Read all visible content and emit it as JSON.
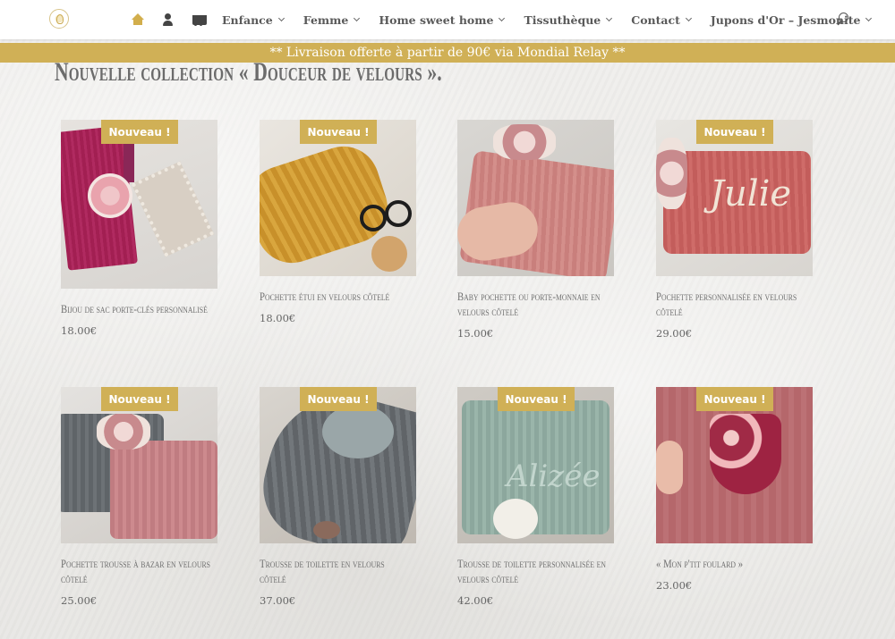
{
  "nav": {
    "items": [
      {
        "label": "Enfance"
      },
      {
        "label": "Femme"
      },
      {
        "label": "Home sweet home"
      },
      {
        "label": "Tissuthèque"
      },
      {
        "label": "Contact"
      },
      {
        "label": "Jupons d'Or – Jesmonite"
      }
    ]
  },
  "banner": {
    "text": "** Livraison offerte à partir de 90€ via Mondial Relay **"
  },
  "section": {
    "title": "Nouvelle collection « Douceur de velours »."
  },
  "badge_label": "Nouveau !",
  "products": [
    {
      "title": "Bijou de sac porte-clés personnalisé",
      "price": "18.00€",
      "badge": "Nouveau !"
    },
    {
      "title": "Pochette étui en velours côtelé",
      "price": "18.00€",
      "badge": "Nouveau !"
    },
    {
      "title": "Baby pochette ou porte-monnaie en velours côtelé",
      "price": "15.00€",
      "badge": ""
    },
    {
      "title": "Pochette personnalisée en velours côtelé",
      "price": "29.00€",
      "badge": "Nouveau !"
    },
    {
      "title": "Pochette trousse à bazar en velours côtelé",
      "price": "25.00€",
      "badge": "Nouveau !"
    },
    {
      "title": "Trousse de toilette en velours côtelé",
      "price": "37.00€",
      "badge": "Nouveau !"
    },
    {
      "title": "Trousse de toilette personnalisée en velours côtelé",
      "price": "42.00€",
      "badge": "Nouveau !"
    },
    {
      "title": "« Mon p'tit foulard »",
      "price": "23.00€",
      "badge": "Nouveau !"
    }
  ],
  "colors": {
    "accent": "#d0b056",
    "text": "#5a5a5a",
    "header": "#ffffff"
  },
  "icons": [
    "logo-icon",
    "home-icon",
    "user-icon",
    "cart-icon",
    "search-icon"
  ]
}
